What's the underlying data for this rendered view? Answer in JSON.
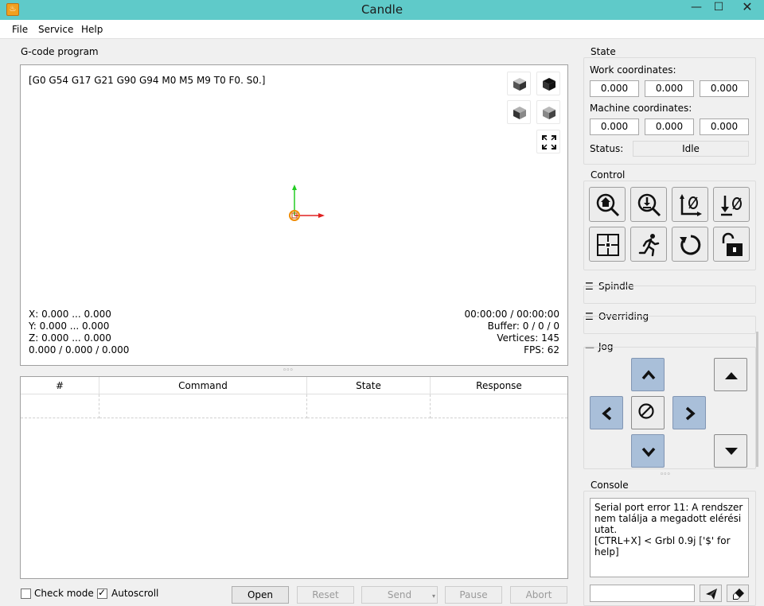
{
  "window": {
    "title": "Candle",
    "icon_glyph": "♨",
    "minimize_glyph": "—",
    "maximize_glyph": "☐",
    "close_glyph": "✕"
  },
  "menu": [
    "File",
    "Service",
    "Help"
  ],
  "gcode_group": {
    "label": "G-code program",
    "gcode_line": "[G0 G54 G17 G21 G90 G94 M0 M5 M9 T0 F0. S0.]",
    "info_left": [
      "X: 0.000 ... 0.000",
      "Y: 0.000 ... 0.000",
      "Z: 0.000 ... 0.000",
      "0.000 / 0.000 / 0.000"
    ],
    "info_right": [
      "00:00:00 / 00:00:00",
      "Buffer: 0 / 0 / 0",
      "Vertices: 145",
      "FPS: 62"
    ]
  },
  "table": {
    "columns": [
      "#",
      "Command",
      "State",
      "Response"
    ]
  },
  "bottom": {
    "check_mode": "Check mode",
    "autoscroll": "Autoscroll",
    "open": "Open",
    "reset": "Reset",
    "send": "Send",
    "pause": "Pause",
    "abort": "Abort"
  },
  "state": {
    "label": "State",
    "work_label": "Work coordinates:",
    "work": [
      "0.000",
      "0.000",
      "0.000"
    ],
    "machine_label": "Machine coordinates:",
    "machine": [
      "0.000",
      "0.000",
      "0.000"
    ],
    "status_label": "Status:",
    "status_value": "Idle"
  },
  "control": {
    "label": "Control"
  },
  "spindle": {
    "label": "Spindle"
  },
  "overriding": {
    "label": "Overriding"
  },
  "jog": {
    "label": "Jog"
  },
  "console": {
    "label": "Console",
    "lines": [
      "Serial port error 11: A rendszer nem találja a megadott elérési utat.",
      "[CTRL+X] < Grbl 0.9j ['$' for help]"
    ]
  },
  "colors": {
    "titlebar": "#5fcac9",
    "jog_blue": "#a9bfd9"
  }
}
